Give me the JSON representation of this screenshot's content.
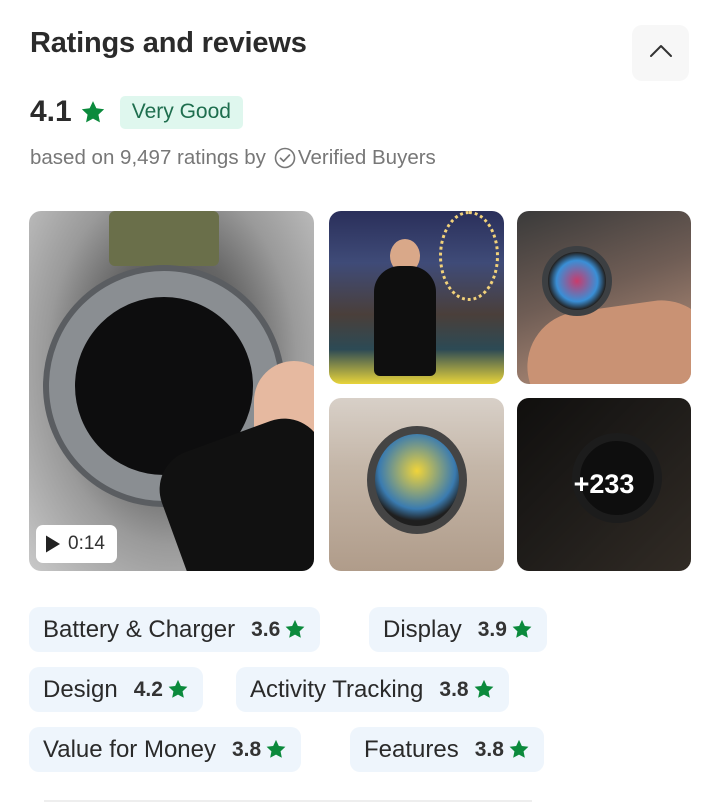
{
  "header": {
    "title": "Ratings and reviews",
    "collapse_icon": "chevron-up-icon"
  },
  "summary": {
    "rating": "4.1",
    "star_color": "#0b8a3c",
    "badge_label": "Very Good",
    "badge_bg": "#dff7ee",
    "badge_text_color": "#1e6e4e",
    "based_on_text": "based on 9,497 ratings by",
    "verified_label": "Verified Buyers"
  },
  "gallery": {
    "video_duration": "0:14",
    "more_count": "+233",
    "tiles": [
      {
        "name": "review-video-thumbnail",
        "kind": "video"
      },
      {
        "name": "review-photo",
        "kind": "photo"
      },
      {
        "name": "review-photo",
        "kind": "photo"
      },
      {
        "name": "review-photo",
        "kind": "photo"
      },
      {
        "name": "review-photo-more",
        "kind": "photo"
      }
    ]
  },
  "aspects": [
    {
      "label": "Battery & Charger",
      "score": "3.6"
    },
    {
      "label": "Display",
      "score": "3.9"
    },
    {
      "label": "Design",
      "score": "4.2"
    },
    {
      "label": "Activity Tracking",
      "score": "3.8"
    },
    {
      "label": "Value for Money",
      "score": "3.8"
    },
    {
      "label": "Features",
      "score": "3.8"
    }
  ],
  "colors": {
    "chip_bg": "#eef5fc",
    "star_green": "#0b8a3c"
  }
}
